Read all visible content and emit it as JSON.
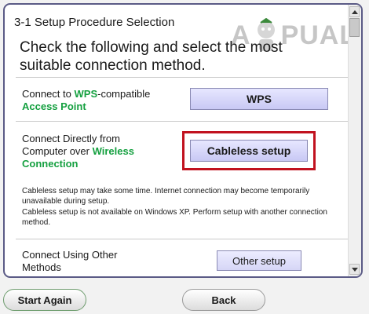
{
  "window": {
    "step_title": "3-1 Setup Procedure Selection",
    "headline": "Check the following and select the most suitable connection method."
  },
  "watermark": {
    "text_before": "A",
    "text_after": "PUALS",
    "icon": "mascot-logo"
  },
  "options": {
    "wps": {
      "label_pre": "Connect to ",
      "label_hl1": "WPS",
      "label_mid": "-compatible",
      "label_hl2": "Access Point",
      "button": "WPS"
    },
    "cableless": {
      "label_line1": "Connect Directly from",
      "label_line2_pre": "Computer over ",
      "label_line2_hl": "Wireless",
      "label_line3_hl": "Connection",
      "button": "Cableless setup",
      "note1": "Cableless setup may take some time. Internet connection may become temporarily unavailable during setup.",
      "note2": "Cableless setup is not available on Windows XP. Perform setup with another connection method."
    },
    "other": {
      "label_line1": "Connect Using Other",
      "label_line2": "Methods",
      "button": "Other setup"
    }
  },
  "footer": {
    "start_again": "Start Again",
    "back": "Back"
  },
  "colors": {
    "highlight_text": "#15a040",
    "annotation_box": "#c1121f",
    "button_fill": "#d4d4f8"
  }
}
